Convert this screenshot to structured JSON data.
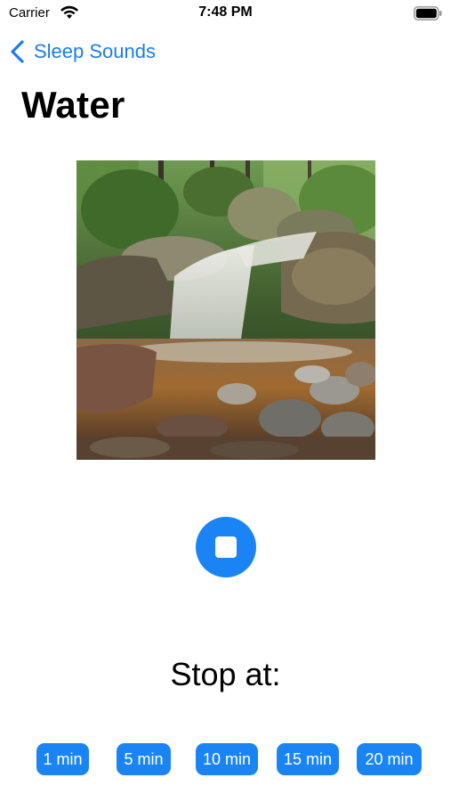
{
  "status_bar": {
    "carrier": "Carrier",
    "time": "7:48 PM",
    "wifi_icon": "wifi-icon",
    "battery_icon": "battery-icon"
  },
  "nav": {
    "back_icon": "chevron-left-icon",
    "back_label": "Sleep Sounds"
  },
  "page": {
    "title": "Water",
    "image_subject": "waterfall-photo"
  },
  "player": {
    "stop_icon": "stop-icon",
    "stop_at_label": "Stop at:"
  },
  "timers": [
    {
      "label": "1 min"
    },
    {
      "label": "5 min"
    },
    {
      "label": "10 min"
    },
    {
      "label": "15 min"
    },
    {
      "label": "20 min"
    }
  ],
  "colors": {
    "accent": "#1a84f5",
    "link": "#1a7cf3"
  }
}
